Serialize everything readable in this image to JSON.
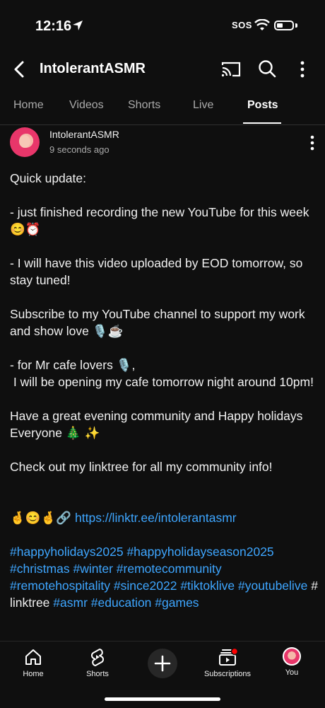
{
  "status": {
    "time": "12:16",
    "sos": "SOS"
  },
  "app_bar": {
    "title": "IntolerantASMR"
  },
  "tabs": [
    {
      "label": "Home",
      "active": false
    },
    {
      "label": "Videos",
      "active": false
    },
    {
      "label": "Shorts",
      "active": false
    },
    {
      "label": "Live",
      "active": false
    },
    {
      "label": "Posts",
      "active": true
    }
  ],
  "post": {
    "author": "IntolerantASMR",
    "timestamp": "9 seconds ago",
    "lines": {
      "l1": "Quick update:",
      "l2": "- just finished recording the new YouTube for this week 😊⏰",
      "l3": "- I will have this video uploaded by EOD tomorrow, so stay tuned!",
      "l4": "Subscribe to my YouTube channel to support my work and show love 🎙️☕",
      "l5a": "- for Mr cafe lovers 🎙️,",
      "l5b": " I will be opening my cafe tomorrow night around 10pm!",
      "l6": "Have a great evening community and Happy holidays Everyone 🎄 ✨",
      "l7": "Check out my linktree for all my community info!",
      "emoji_prefix": "🤞😊🤞🔗 ",
      "link": "https://linktr.ee/intolerantasmr"
    },
    "hashtags": {
      "h1": "#happyholidays2025",
      "h2": "#happyholidayseason2025",
      "h3": "#christmas",
      "h4": "#winter",
      "h5": "#remotecommunity",
      "h6": "#remotehospitality",
      "h7": "#since2022",
      "h8": "#tiktoklive",
      "h9": "#youtubelive",
      "plain": "# linktree ",
      "h10": "#asmr",
      "h11": "#education",
      "h12": "#games"
    }
  },
  "bottom_nav": {
    "home": "Home",
    "shorts": "Shorts",
    "subscriptions": "Subscriptions",
    "you": "You"
  },
  "colors": {
    "background": "#0f0f0f",
    "link": "#3ea6ff",
    "notification_dot": "#ff0000"
  }
}
